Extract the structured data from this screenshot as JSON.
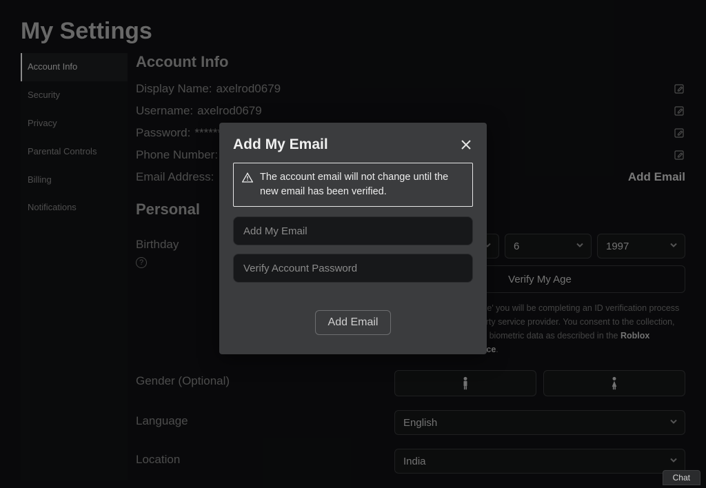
{
  "page": {
    "title": "My Settings"
  },
  "sidebar": {
    "items": [
      {
        "label": "Account Info",
        "active": true
      },
      {
        "label": "Security"
      },
      {
        "label": "Privacy"
      },
      {
        "label": "Parental Controls"
      },
      {
        "label": "Billing"
      },
      {
        "label": "Notifications"
      }
    ]
  },
  "account": {
    "heading": "Account Info",
    "display_name_label": "Display Name:",
    "display_name_value": "axelrod0679",
    "username_label": "Username:",
    "username_value": "axelrod0679",
    "password_label": "Password:",
    "password_value": "********",
    "phone_label": "Phone Number:",
    "email_label": "Email Address:",
    "add_email_link": "Add Email"
  },
  "personal": {
    "heading": "Personal",
    "birthday_label": "Birthday",
    "month": "",
    "day": "6",
    "year": "1997",
    "verify_btn": "Verify My Age",
    "note_prefix": "By clicking 'Verify My Age' you will be completing an ID verification process operated by our third party service provider. You consent to the collection, use, and sharing of your biometric data as described in the ",
    "note_link": "Roblox Biometric Privacy Notice",
    "note_suffix": ".",
    "gender_label": "Gender (Optional)",
    "language_label": "Language",
    "language_value": "English",
    "location_label": "Location",
    "location_value": "India"
  },
  "modal": {
    "title": "Add My Email",
    "warning": "The account email will not change until the new email has been verified.",
    "email_placeholder": "Add My Email",
    "password_placeholder": "Verify Account Password",
    "submit": "Add Email"
  },
  "chat": {
    "label": "Chat"
  }
}
